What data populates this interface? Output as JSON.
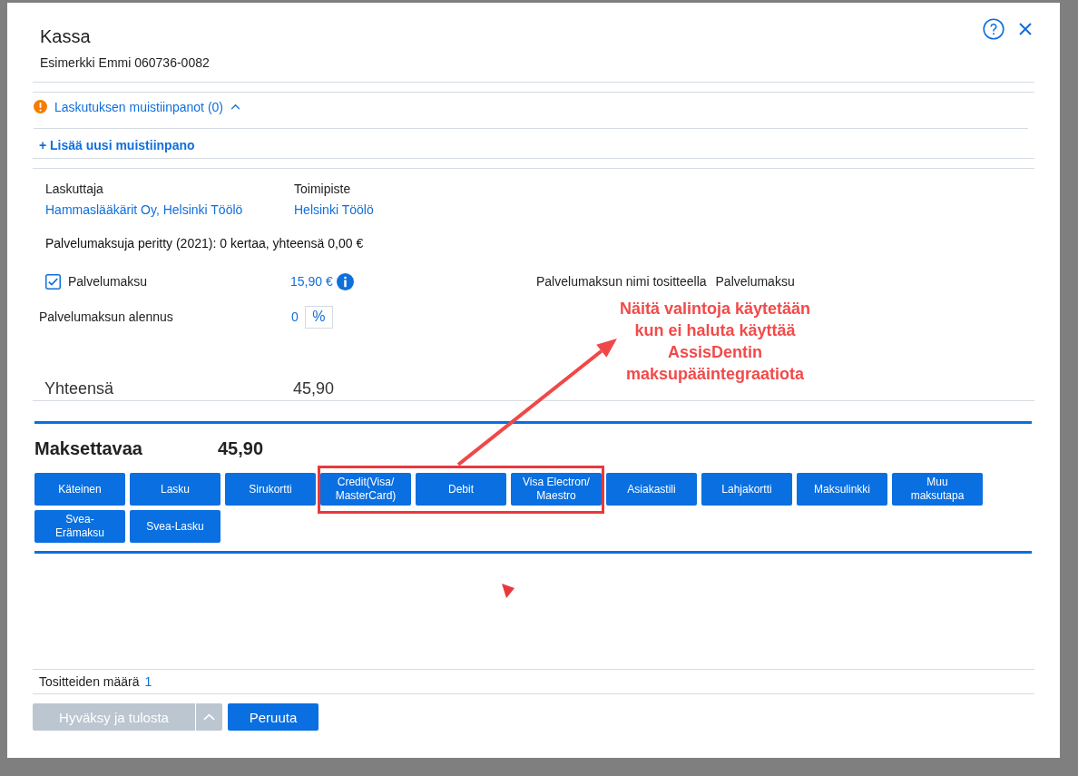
{
  "dialog": {
    "title": "Kassa",
    "subtitle": "Esimerkki Emmi 060736-0082"
  },
  "notes": {
    "label": "Laskutuksen muistiinpanot (0)",
    "expanded": true,
    "add_link": "+ Lisää uusi muistiinpano"
  },
  "billing": {
    "fields": [
      {
        "label": "Laskuttaja",
        "value": "Hammaslääkärit Oy, Helsinki Töölö"
      },
      {
        "label": "Toimipiste",
        "value": "Helsinki Töölö"
      }
    ],
    "fees_info": "Palvelumaksuja peritty (2021): 0 kertaa, yhteensä 0,00 €",
    "service_fee": {
      "label": "Palvelumaksu",
      "checked": true,
      "amount": "15,90 €"
    },
    "receipt_name": {
      "label": "Palvelumaksun nimi tositteella",
      "value": "Palvelumaksu"
    },
    "discount": {
      "label": "Palvelumaksun alennus",
      "value": "0",
      "unit": "%"
    },
    "total": {
      "label": "Yhteensä",
      "value": "45,90"
    }
  },
  "payment": {
    "label": "Maksettavaa",
    "amount": "45,90",
    "methods": [
      {
        "label": "Käteinen",
        "highlighted": false
      },
      {
        "label": "Lasku",
        "highlighted": false
      },
      {
        "label": "Sirukortti",
        "highlighted": false
      },
      {
        "label": "Credit(Visa/ MasterCard)",
        "highlighted": true
      },
      {
        "label": "Debit",
        "highlighted": true
      },
      {
        "label": "Visa Electron/ Maestro",
        "highlighted": true
      },
      {
        "label": "Asiakastili",
        "highlighted": false
      },
      {
        "label": "Lahjakortti",
        "highlighted": false
      },
      {
        "label": "Maksulinkki",
        "highlighted": false
      },
      {
        "label": "Muu maksutapa",
        "highlighted": false
      },
      {
        "label": "Svea-Erämaksu",
        "highlighted": false
      },
      {
        "label": "Svea-Lasku",
        "highlighted": false
      }
    ]
  },
  "annotation": {
    "text": "Näitä valintoja käytetään kun ei haluta käyttää AssisDentin maksupääintegraatiota"
  },
  "footer": {
    "count_label": "Tositteiden määrä",
    "count": "1",
    "approve": {
      "label": "Hyväksy ja tulosta",
      "disabled": true
    },
    "cancel": "Peruuta"
  }
}
